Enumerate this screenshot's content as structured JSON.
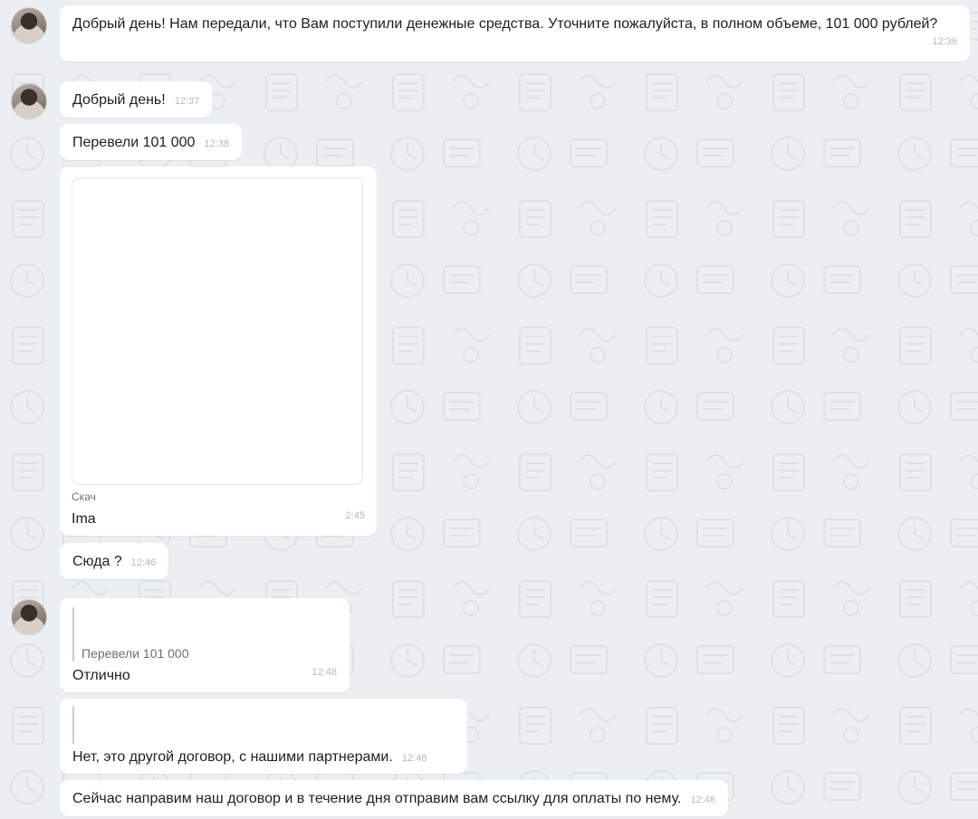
{
  "messages": [
    {
      "text": "Добрый день! Нам передали, что Вам поступили денежные средства. Уточните пожалуйста, в полном объеме, 101 000 рублей?",
      "time": "12:36"
    },
    {
      "text": "Добрый день!",
      "time": "12:37"
    },
    {
      "text": "Перевели 101 000",
      "time": "12:38"
    },
    {
      "download_label": "Скач",
      "caption": "Ima",
      "time": "2:45"
    },
    {
      "text": "Сюда ?",
      "time": "12:46"
    },
    {
      "quote": "Перевели 101 000",
      "text": "Отлично",
      "time": "12:48"
    },
    {
      "text": "Нет, это другой договор, с нашими партнерами.",
      "time": "12:48"
    },
    {
      "text": "Сейчас направим наш договор и в течение дня отправим вам ссылку для оплаты по нему.",
      "time": "12:48"
    }
  ],
  "icons": {
    "avatar": "user-avatar",
    "background_pattern": "doodle-pattern"
  },
  "colors": {
    "background": "#eceff2",
    "bubble": "#ffffff",
    "timestamp": "#b4b8bd",
    "quote_bar": "#c7cbd0"
  }
}
